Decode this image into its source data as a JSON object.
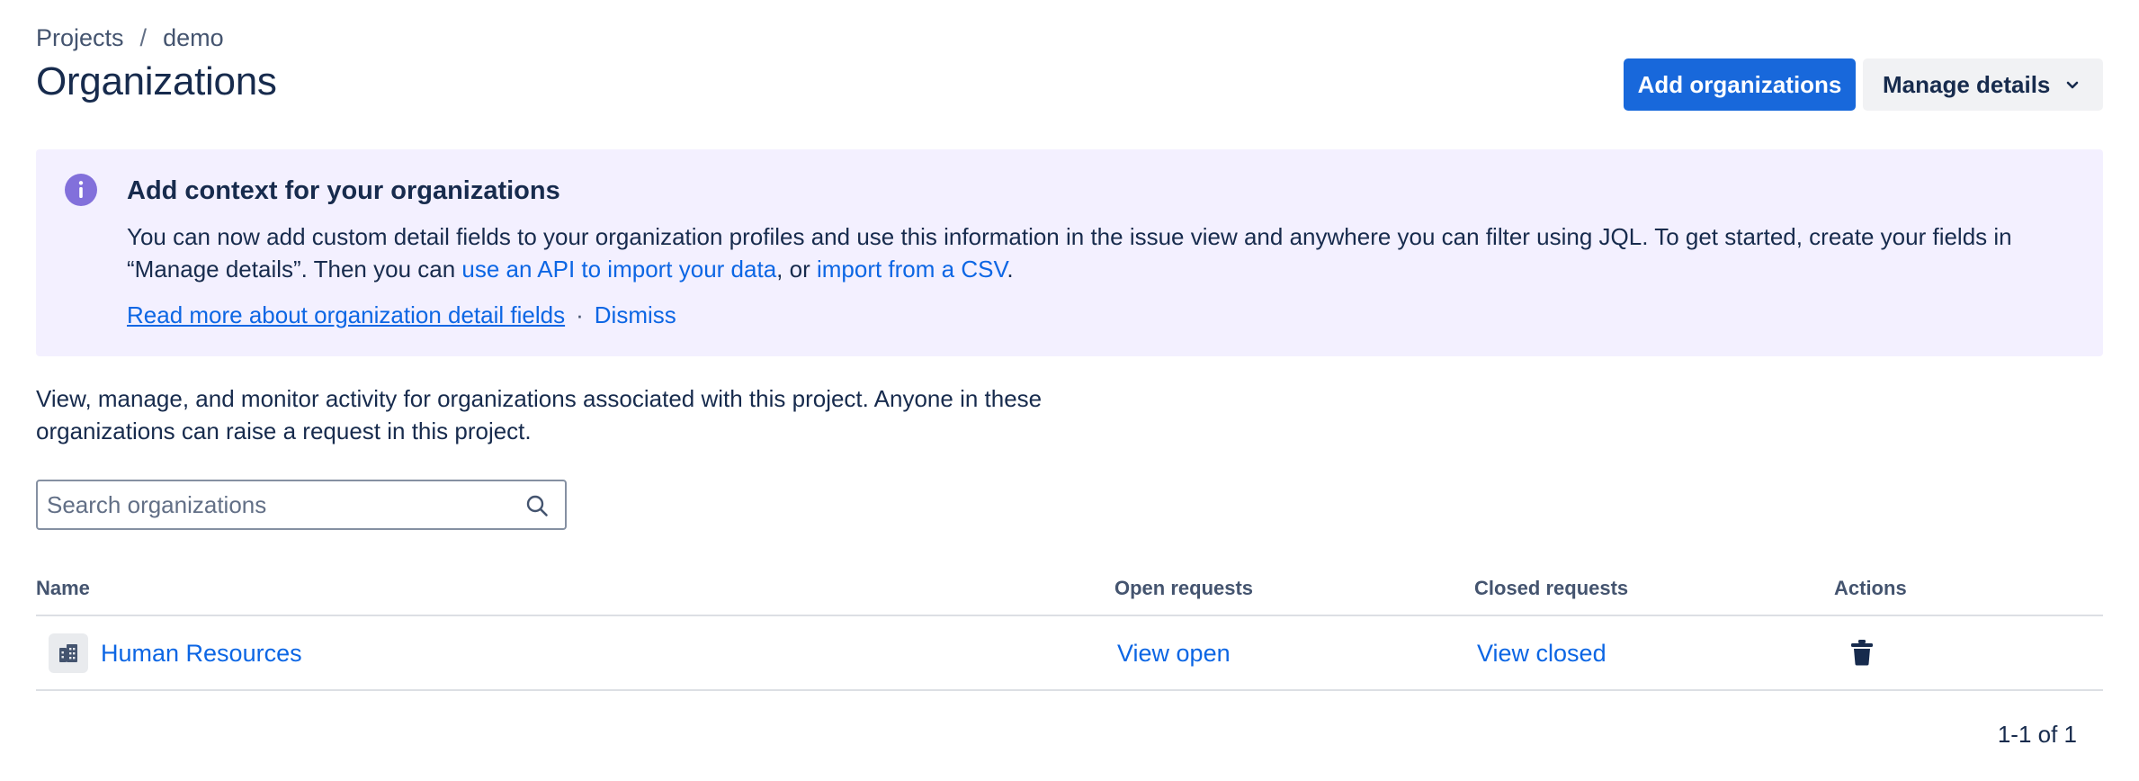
{
  "breadcrumb": {
    "items": [
      "Projects",
      "demo"
    ],
    "separator": "/"
  },
  "page": {
    "title": "Organizations"
  },
  "actions": {
    "add_label": "Add organizations",
    "manage_label": "Manage details"
  },
  "banner": {
    "title": "Add context for your organizations",
    "body_prefix": "You can now add custom detail fields to your organization profiles and use this information in the issue view and anywhere you can filter using JQL. To get started, create your fields in “Manage details”. Then you can ",
    "api_link": "use an API to import your data",
    "body_middle": ", or ",
    "csv_link": "import from a CSV",
    "body_suffix": ".",
    "read_more_link": "Read more about organization detail fields",
    "dot": "·",
    "dismiss_link": "Dismiss"
  },
  "description": "View, manage, and monitor activity for organizations associated with this project. Anyone in these organizations can raise a request in this project.",
  "search": {
    "placeholder": "Search organizations",
    "value": ""
  },
  "table": {
    "columns": [
      "Name",
      "Open requests",
      "Closed requests",
      "Actions"
    ],
    "rows": [
      {
        "name": "Human Resources",
        "open": "View open",
        "closed": "View closed",
        "action_icon": "trash-icon"
      }
    ]
  },
  "pagination": "1-1 of 1",
  "colors": {
    "primary": "#1868db",
    "link": "#0c66e4",
    "banner_bg": "#f3f0ff",
    "info_icon": "#8270db",
    "text": "#172b4d"
  }
}
